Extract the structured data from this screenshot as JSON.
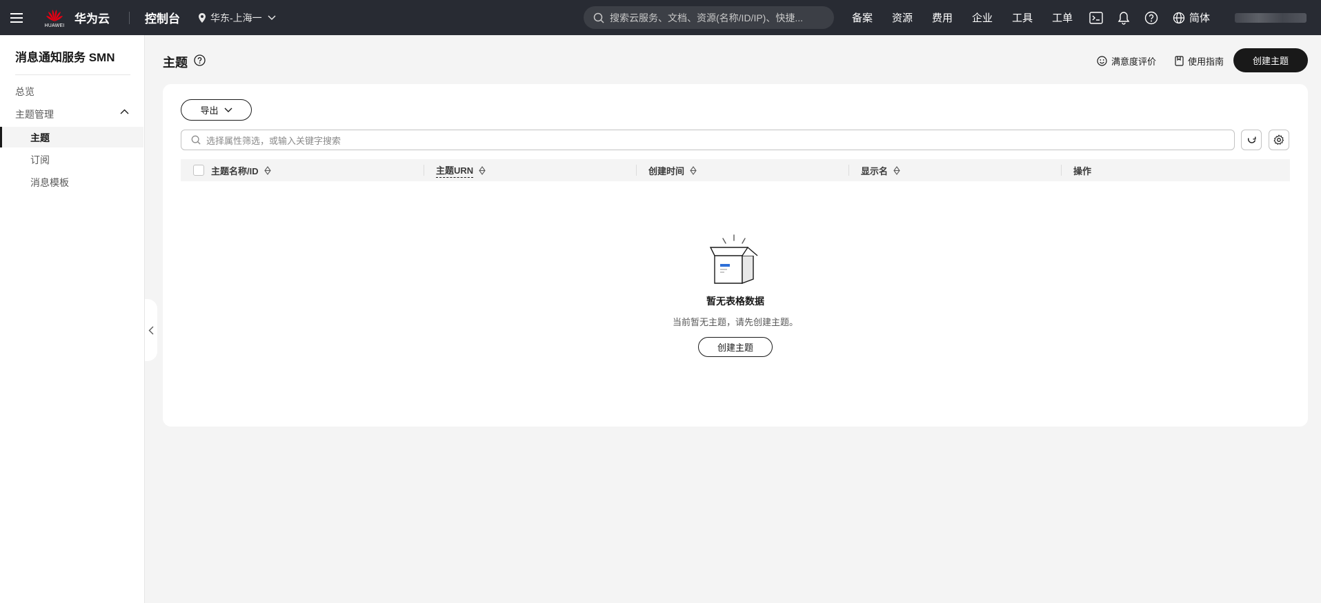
{
  "topbar": {
    "brand_word": "HUAWEI",
    "brand_name": "华为云",
    "console": "控制台",
    "region": "华东-上海一",
    "search_placeholder": "搜索云服务、文档、资源(名称/ID/IP)、快捷...",
    "nav": [
      "备案",
      "资源",
      "费用",
      "企业",
      "工具",
      "工单"
    ],
    "language": "简体"
  },
  "sidebar": {
    "title": "消息通知服务 SMN",
    "items": {
      "overview": "总览",
      "topic_mgmt": "主题管理",
      "topic": "主题",
      "subscription": "订阅",
      "template": "消息模板"
    }
  },
  "header": {
    "title": "主题",
    "satisfaction": "满意度评价",
    "guide": "使用指南",
    "create": "创建主题"
  },
  "toolbar": {
    "export": "导出",
    "filter_placeholder": "选择属性筛选，或输入关键字搜索"
  },
  "table": {
    "columns": [
      "主题名称/ID",
      "主题URN",
      "创建时间",
      "显示名",
      "操作"
    ]
  },
  "empty": {
    "title": "暂无表格数据",
    "description": "当前暂无主题，请先创建主题。",
    "button": "创建主题"
  },
  "colors": {
    "topbar_bg": "#282b33",
    "primary_button": "#191919",
    "page_bg": "#f4f4f4",
    "logo_red": "#e60012",
    "accent_blue": "#2e6fd8"
  }
}
